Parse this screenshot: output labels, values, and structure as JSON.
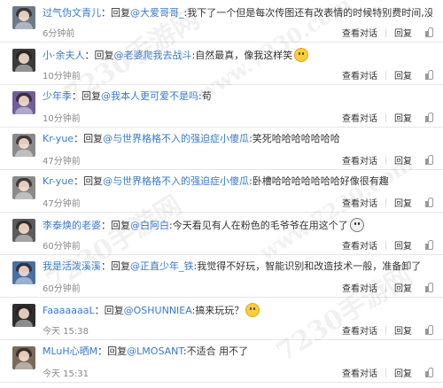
{
  "actions": {
    "view_dialog": "查看对话",
    "reply": "回复"
  },
  "reply_prefix": "回复",
  "colors": {
    "link": "#3a79c9",
    "text": "#333333",
    "time": "#888888",
    "divider": "#e6e6e6"
  },
  "comments": [
    {
      "avatar_color": "#6d7a8a",
      "name": "过气伪文青儿",
      "mention": "@大爱哥哥_",
      "text": ":我下了一个但是每次传图还有改表情的时候特别费时间,没有耐心了",
      "emoji": "dark",
      "time": "6分钟前"
    },
    {
      "avatar_color": "#3b3b3b",
      "name": "小·余夫人",
      "mention": "@老婆爬我去战斗",
      "text": ":自然最真，像我这样笑",
      "emoji": "yellow",
      "time": "10分钟前"
    },
    {
      "avatar_color": "#6f5e99",
      "name": "少年季",
      "mention": "@我本人更可爱不是吗",
      "text": ":苟",
      "emoji": "",
      "time": "10分钟前"
    },
    {
      "avatar_color": "#8a8a8a",
      "name": "Kr-yue",
      "mention": "@与世界格格不入的强迫症小傻瓜",
      "text": ":笑死哈哈哈哈哈哈哈",
      "emoji": "",
      "time": "47分钟前"
    },
    {
      "avatar_color": "#8a8a8a",
      "name": "Kr-yue",
      "mention": "@与世界格格不入的强迫症小傻瓜",
      "text": ":卧槽哈哈哈哈哈哈哈好像很有趣",
      "emoji": "",
      "time": "47分钟前"
    },
    {
      "avatar_color": "#5c5c5c",
      "name": "李泰焕的老婆",
      "mention": "@白阿白",
      "text": ":今天看见有人在粉色的毛爷爷在用这个了",
      "emoji": "dark",
      "time": "60分钟前"
    },
    {
      "avatar_color": "#4a6fa5",
      "name": "我是活泼溪溪",
      "mention": "@正直少年_铁",
      "text": ":我觉得不好玩，智能识别和改造技术一般，准备卸了",
      "emoji": "",
      "time": "60分钟前"
    },
    {
      "avatar_color": "#2e2e2e",
      "name": "FaaaaaaaL",
      "mention": "@OSHUNNIEA",
      "text": ":搞来玩玩？",
      "emoji": "yellow",
      "time": "今天 15:38"
    },
    {
      "avatar_color": "#7a6a5a",
      "name": "MLuH心晒M",
      "mention": "@LMOSANT",
      "text": ":不适合 用不了",
      "emoji": "",
      "time": "今天 15:31"
    }
  ],
  "watermark": {
    "text_a": "7230手游网",
    "text_b": "www.7230.com"
  }
}
